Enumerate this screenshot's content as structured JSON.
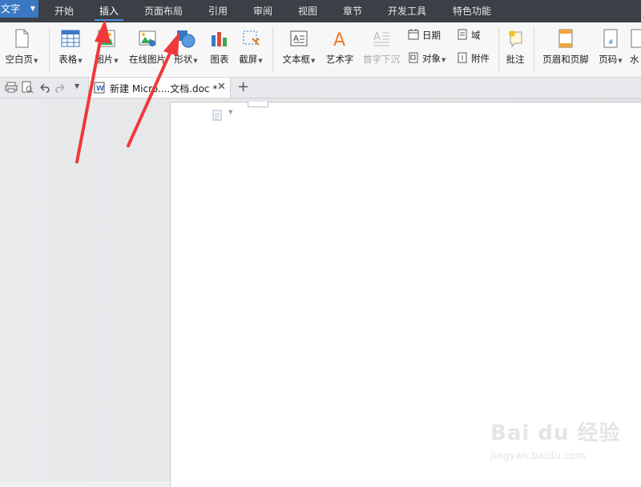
{
  "app": {
    "name": "文字"
  },
  "menu": {
    "tabs": [
      {
        "label": "开始"
      },
      {
        "label": "插入"
      },
      {
        "label": "页面布局"
      },
      {
        "label": "引用"
      },
      {
        "label": "审阅"
      },
      {
        "label": "视图"
      },
      {
        "label": "章节"
      },
      {
        "label": "开发工具"
      },
      {
        "label": "特色功能"
      }
    ],
    "active": "插入"
  },
  "ribbon": {
    "blank_page": "空白页",
    "table": "表格",
    "picture": "图片",
    "online_picture": "在线图片",
    "shape": "形状",
    "chart": "图表",
    "screenshot": "截屏",
    "textbox": "文本框",
    "wordart": "艺术字",
    "drop_cap": "首字下沉",
    "date": "日期",
    "field": "域",
    "object": "对象",
    "attachment": "附件",
    "comment": "批注",
    "header_footer": "页眉和页脚",
    "page_number": "页码",
    "watermark_partial": "水"
  },
  "document": {
    "tab_title": "新建 Micro....文档.doc *"
  },
  "watermark": {
    "logo": "Bai du 经验",
    "url": "jingyan.baidu.com"
  },
  "colors": {
    "menubar_bg": "#3b3f46",
    "app_button": "#3b78c4",
    "active_underline": "#4a90e2",
    "annotation_arrow": "#f0393a"
  }
}
